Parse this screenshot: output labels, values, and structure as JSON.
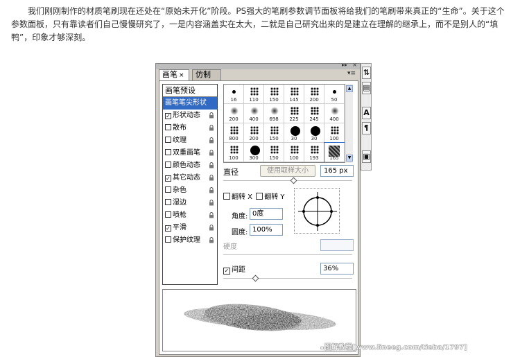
{
  "article": {
    "text": "我们刚刚制作的材质笔刷现在还处在“原始未开化”阶段。PS强大的笔刷参数调节面板将给我们的笔刷带来真正的“生命”。关于这个参数面板，只有靠读者们自己慢慢研究了，一是内容涵盖实在太大，二就是自己研究出来的是建立在理解的继承上，而不是别人的“填鸭”，印象才够深刻。"
  },
  "panel": {
    "tabs": [
      {
        "label": "画笔"
      },
      {
        "label": "仿制源"
      }
    ],
    "list_header": "画笔预设",
    "options": [
      {
        "label": "画笔笔尖形状",
        "checkbox": false,
        "checked": false,
        "selected": true,
        "lock": false
      },
      {
        "label": "形状动态",
        "checkbox": true,
        "checked": true,
        "selected": false,
        "lock": true
      },
      {
        "label": "散布",
        "checkbox": true,
        "checked": false,
        "selected": false,
        "lock": true
      },
      {
        "label": "纹理",
        "checkbox": true,
        "checked": false,
        "selected": false,
        "lock": true
      },
      {
        "label": "双重画笔",
        "checkbox": true,
        "checked": false,
        "selected": false,
        "lock": true
      },
      {
        "label": "颜色动态",
        "checkbox": true,
        "checked": false,
        "selected": false,
        "lock": true
      },
      {
        "label": "其它动态",
        "checkbox": true,
        "checked": true,
        "selected": false,
        "lock": true
      },
      {
        "label": "杂色",
        "checkbox": true,
        "checked": false,
        "selected": false,
        "lock": true
      },
      {
        "label": "湿边",
        "checkbox": true,
        "checked": false,
        "selected": false,
        "lock": true
      },
      {
        "label": "喷枪",
        "checkbox": true,
        "checked": false,
        "selected": false,
        "lock": true
      },
      {
        "label": "平滑",
        "checkbox": true,
        "checked": true,
        "selected": false,
        "lock": true
      },
      {
        "label": "保护纹理",
        "checkbox": true,
        "checked": false,
        "selected": false,
        "lock": true
      }
    ],
    "brush_sizes": [
      "16",
      "110",
      "150",
      "145",
      "200",
      "50",
      "200",
      "400",
      "698",
      "225",
      "245",
      "400",
      "800",
      "200",
      "150",
      "30",
      "30",
      "100",
      "100",
      "300",
      "150",
      "100",
      "193",
      "165"
    ],
    "diameter_label": "直径",
    "sample_button": "使用取样大小",
    "diameter_value": "165 px",
    "diameter_level": 0.55,
    "flip_x_label": "翻转 X",
    "flip_y_label": "翻转 Y",
    "angle_label": "角度:",
    "angle_value": "0度",
    "roundness_label": "圆度:",
    "roundness_value": "100%",
    "hardness_label": "硬度",
    "spacing_label": "间距",
    "spacing_checked": "✓",
    "spacing_value": "36%",
    "spacing_level": 0.25
  },
  "side_toolbar": [
    "A",
    "¶"
  ],
  "watermark": "图解教程[www.lineeg.com/tieba/1797]"
}
